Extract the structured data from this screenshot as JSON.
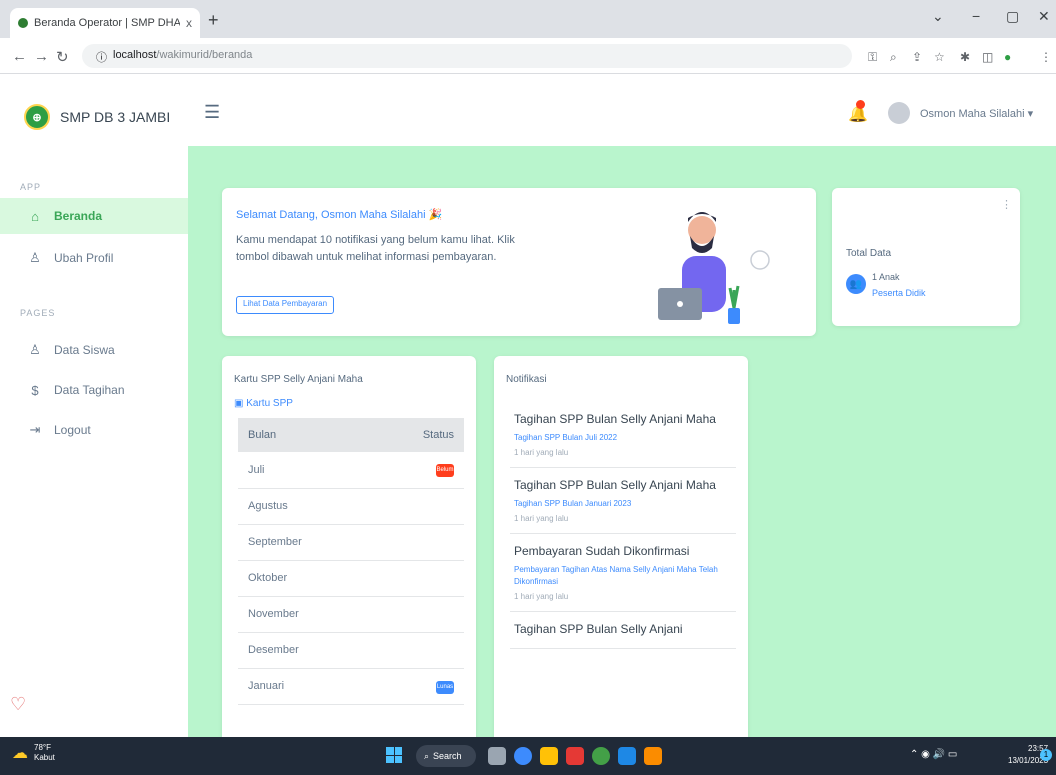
{
  "browser": {
    "tab_title": "Beranda Operator | SMP DHARM",
    "tab_close": "x",
    "newtab": "+",
    "url_host": "localhost",
    "url_path": "/wakimurid/beranda",
    "controls": {
      "minimize": "−",
      "restore": "▢",
      "close": "✕",
      "dropdown": "⌄"
    }
  },
  "sidebar": {
    "brand": "SMP DB 3 JAMBI",
    "section_app": "APP",
    "section_pages": "PAGES",
    "items": [
      {
        "label": "Beranda",
        "icon": "home-icon",
        "glyph": "⌂",
        "active": true
      },
      {
        "label": "Ubah Profil",
        "icon": "user-icon",
        "glyph": "♙",
        "active": false
      },
      {
        "label": "Data Siswa",
        "icon": "user-icon",
        "glyph": "♙",
        "active": false
      },
      {
        "label": "Data Tagihan",
        "icon": "dollar-icon",
        "glyph": "$",
        "active": false
      },
      {
        "label": "Logout",
        "icon": "logout-icon",
        "glyph": "⇥",
        "active": false
      }
    ]
  },
  "topnav": {
    "user_name": "Osmon Maha Silalahi ▾"
  },
  "welcome": {
    "title": "Selamat Datang, Osmon Maha Silalahi 🎉",
    "text": "Kamu mendapat 10 notifikasi yang belum kamu lihat. Klik tombol dibawah untuk melihat informasi pembayaran.",
    "button": "Lihat Data Pembayaran"
  },
  "total": {
    "title": "Total Data",
    "count": "1 Anak",
    "label": "Peserta Didik"
  },
  "spp": {
    "title": "Kartu SPP Selly Anjani Maha",
    "link": "Kartu SPP",
    "col_bulan": "Bulan",
    "col_status": "Status",
    "rows": [
      {
        "bulan": "Juli",
        "status": "Belum",
        "color": "#ff3e1d"
      },
      {
        "bulan": "Agustus",
        "status": "",
        "color": ""
      },
      {
        "bulan": "September",
        "status": "",
        "color": ""
      },
      {
        "bulan": "Oktober",
        "status": "",
        "color": ""
      },
      {
        "bulan": "November",
        "status": "",
        "color": ""
      },
      {
        "bulan": "Desember",
        "status": "",
        "color": ""
      },
      {
        "bulan": "Januari",
        "status": "Lunas",
        "color": "#3d8bfd"
      }
    ]
  },
  "notifications": {
    "title": "Notifikasi",
    "items": [
      {
        "title": "Tagihan SPP Bulan Selly Anjani Maha",
        "desc": "Tagihan SPP Bulan Juli 2022",
        "time": "1 hari yang lalu"
      },
      {
        "title": "Tagihan SPP Bulan Selly Anjani Maha",
        "desc": "Tagihan SPP Bulan Januari 2023",
        "time": "1 hari yang lalu"
      },
      {
        "title": "Pembayaran Sudah Dikonfirmasi",
        "desc": "Pembayaran Tagihan Atas Nama Selly Anjani Maha Telah Dikonfirmasi",
        "time": "1 hari yang lalu"
      },
      {
        "title": "Tagihan SPP Bulan Selly Anjani",
        "desc": "",
        "time": ""
      }
    ]
  },
  "taskbar": {
    "temp": "78°F",
    "weather": "Kabut",
    "search": "Search",
    "time": "23:57",
    "date": "13/01/2023",
    "badge": "1"
  },
  "colors": {
    "accent": "#3d8bfd",
    "sidebar_active": "#d9f9df",
    "content_bg": "#b9f5cd",
    "danger": "#ff3e1d"
  }
}
